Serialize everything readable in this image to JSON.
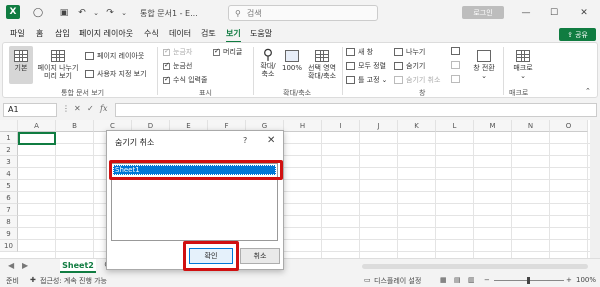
{
  "titlebar": {
    "app_logo": "X",
    "title": "통합 문서1 - E...",
    "search_placeholder": "검색",
    "login_label": "로그인",
    "icons": [
      "save-icon",
      "undo-icon",
      "redo-icon",
      "dropdown-icon",
      "search-icon",
      "minimize-icon",
      "maximize-icon",
      "close-icon"
    ]
  },
  "menu": {
    "tabs": [
      "파일",
      "홈",
      "삽입",
      "페이지 레이아웃",
      "수식",
      "데이터",
      "검토",
      "보기",
      "도움말"
    ],
    "active_tab": "보기",
    "share_label": "공유"
  },
  "ribbon": {
    "workbook_views": {
      "group_label": "통합 문서 보기",
      "normal": "기본",
      "page_break_line1": "페이지 나누기",
      "page_break_line2": "미리 보기",
      "page_layout": "페이지 레이아웃",
      "custom_views": "사용자 지정 보기"
    },
    "show": {
      "group_label": "표시",
      "ruler": "눈금자",
      "ruler_checked": true,
      "formula_bar": "머리글",
      "formula_bar_checked": true,
      "gridlines": "눈금선",
      "gridlines_checked": true,
      "headings": "수식 입력줄",
      "headings_checked": true
    },
    "zoom": {
      "group_label": "확대/축소",
      "zoom_line1": "확대/",
      "zoom_line2": "축소",
      "zoom100": "100%",
      "zoom_sel_line1": "선택 영역",
      "zoom_sel_line2": "확대/축소"
    },
    "window": {
      "group_label": "창",
      "new_window": "새 창",
      "arrange_all": "모두 정렬",
      "freeze": "틀 고정",
      "split": "나누기",
      "hide": "숨기기",
      "unhide": "숨기기 취소",
      "switch_line1": "창 전환",
      "switch_arrow": "⌄"
    },
    "macros": {
      "group_label": "매크로",
      "macros_label": "매크로",
      "macros_arrow": "⌄"
    }
  },
  "formula_bar": {
    "name_box": "A1",
    "fx": "fx",
    "content": ""
  },
  "grid": {
    "columns": [
      "A",
      "B",
      "C",
      "D",
      "E",
      "F",
      "G",
      "H",
      "I",
      "J",
      "K",
      "L",
      "M",
      "N",
      "O"
    ],
    "rows": [
      "1",
      "2",
      "3",
      "4",
      "5",
      "6",
      "7",
      "8",
      "9",
      "10"
    ],
    "selected_cell": "A1"
  },
  "sheets": {
    "tabs": [
      "Sheet2"
    ],
    "active": "Sheet2",
    "add_label": "⊕"
  },
  "status": {
    "ready": "준비",
    "accessibility": "접근성: 계속 진행 가능",
    "display_settings": "디스플레이 설정",
    "zoom_level": "100%"
  },
  "dialog": {
    "title": "숨기기 취소",
    "help": "?",
    "close": "✕",
    "list_items": [
      "Sheet1"
    ],
    "selected_item": "Sheet1",
    "ok_label": "확인",
    "cancel_label": "취소",
    "highlight_color": "#d01010"
  },
  "colors": {
    "accent": "#107c41",
    "selection": "#0078d7"
  }
}
